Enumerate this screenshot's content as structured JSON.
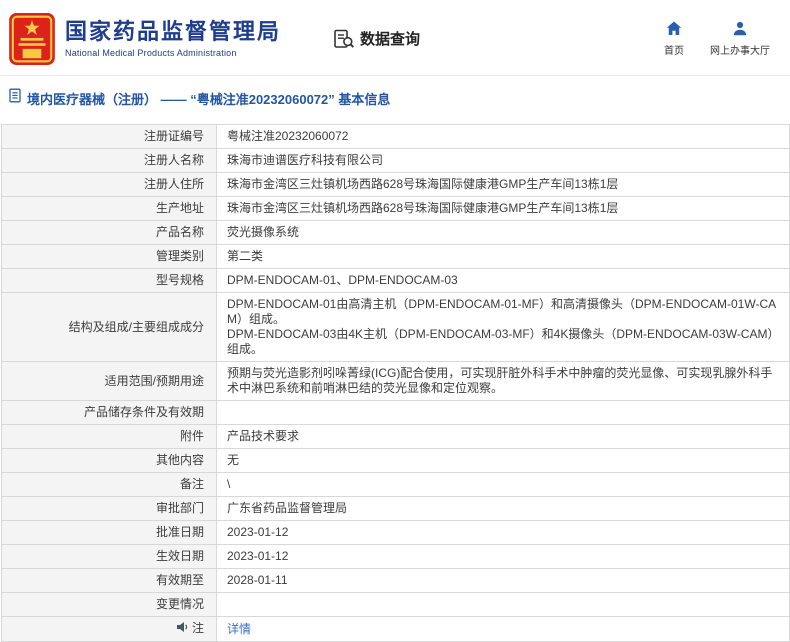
{
  "header": {
    "title": "国家药品监督管理局",
    "subtitle": "National Medical Products Administration",
    "nav_query": "数据查询",
    "nav_home": "首页",
    "nav_hall": "网上办事大厅"
  },
  "breadcrumb": {
    "text": "境内医疗器械（注册） —— “粤械注准20232060072” 基本信息"
  },
  "colors": {
    "brand_blue": "#1e3d8f",
    "emblem_red": "#dd2318",
    "emblem_gold": "#f7c948",
    "link_blue": "#3a6cc8",
    "label_bg": "#f4f4f4"
  },
  "table": {
    "rows": [
      {
        "label": "注册证编号",
        "value": "粤械注准20232060072"
      },
      {
        "label": "注册人名称",
        "value": "珠海市迪谱医疗科技有限公司"
      },
      {
        "label": "注册人住所",
        "value": "珠海市金湾区三灶镇机场西路628号珠海国际健康港GMP生产车间13栋1层"
      },
      {
        "label": "生产地址",
        "value": "珠海市金湾区三灶镇机场西路628号珠海国际健康港GMP生产车间13栋1层"
      },
      {
        "label": "产品名称",
        "value": "荧光摄像系统"
      },
      {
        "label": "管理类别",
        "value": "第二类"
      },
      {
        "label": "型号规格",
        "value": "DPM-ENDOCAM-01、DPM-ENDOCAM-03"
      },
      {
        "label": "结构及组成/主要组成成分",
        "value": "DPM-ENDOCAM-01由高清主机（DPM-ENDOCAM-01-MF）和高清摄像头（DPM-ENDOCAM-01W-CAM）组成。\nDPM-ENDOCAM-03由4K主机（DPM-ENDOCAM-03-MF）和4K摄像头（DPM-ENDOCAM-03W-CAM）组成。",
        "multiline": true
      },
      {
        "label": "适用范围/预期用途",
        "value": "预期与荧光造影剂吲哚菁绿(ICG)配合使用，可实现肝脏外科手术中肿瘤的荧光显像、可实现乳腺外科手术中淋巴系统和前哨淋巴结的荧光显像和定位观察。"
      },
      {
        "label": "产品储存条件及有效期",
        "value": ""
      },
      {
        "label": "附件",
        "value": "产品技术要求"
      },
      {
        "label": "其他内容",
        "value": "无"
      },
      {
        "label": "备注",
        "value": "\\"
      },
      {
        "label": "审批部门",
        "value": "广东省药品监督管理局"
      },
      {
        "label": "批准日期",
        "value": "2023-01-12"
      },
      {
        "label": "生效日期",
        "value": "2023-01-12"
      },
      {
        "label": "有效期至",
        "value": "2028-01-11"
      },
      {
        "label": "变更情况",
        "value": ""
      },
      {
        "label": "注",
        "value": "详情",
        "link": true,
        "icon": "note-icon"
      }
    ]
  }
}
